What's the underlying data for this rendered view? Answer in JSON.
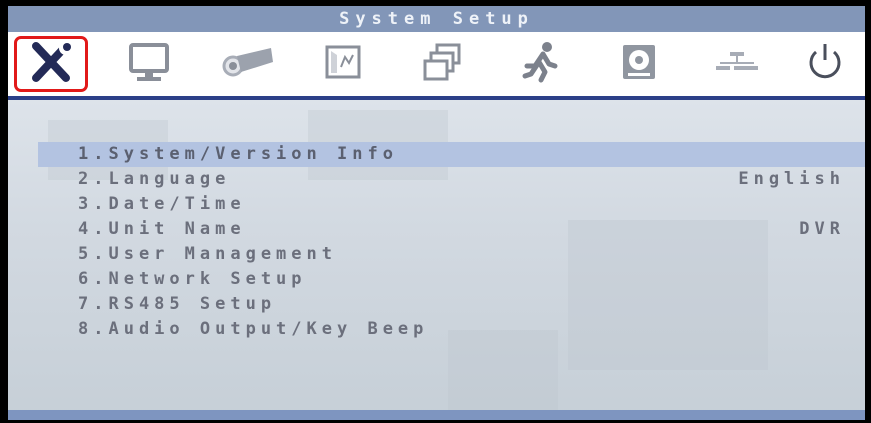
{
  "window": {
    "title": "System Setup"
  },
  "tabs": [
    {
      "icon": "tools-icon",
      "active": true
    },
    {
      "icon": "monitor-icon",
      "active": false
    },
    {
      "icon": "camera-icon",
      "active": false
    },
    {
      "icon": "picture-frame-icon",
      "active": false
    },
    {
      "icon": "windows-stack-icon",
      "active": false
    },
    {
      "icon": "running-person-icon",
      "active": false
    },
    {
      "icon": "hard-disk-icon",
      "active": false
    },
    {
      "icon": "network-icon",
      "active": false
    },
    {
      "icon": "power-icon",
      "active": false
    }
  ],
  "menu": {
    "items": [
      {
        "label": "1.System/Version Info",
        "value": "",
        "selected": true
      },
      {
        "label": "2.Language",
        "value": "English",
        "selected": false
      },
      {
        "label": "3.Date/Time",
        "value": "",
        "selected": false
      },
      {
        "label": "4.Unit Name",
        "value": "DVR",
        "selected": false
      },
      {
        "label": "5.User Management",
        "value": "",
        "selected": false
      },
      {
        "label": "6.Network Setup",
        "value": "",
        "selected": false
      },
      {
        "label": "7.RS485 Setup",
        "value": "",
        "selected": false
      },
      {
        "label": "8.Audio Output/Key Beep",
        "value": "",
        "selected": false
      }
    ]
  },
  "colors": {
    "accent": "#2b3f88",
    "title_bar": "#8296b8",
    "selection": "#b3c3e1",
    "active_tab_border": "#e11919",
    "icon_gray": "#8a8f99",
    "icon_dark": "#222a55"
  }
}
